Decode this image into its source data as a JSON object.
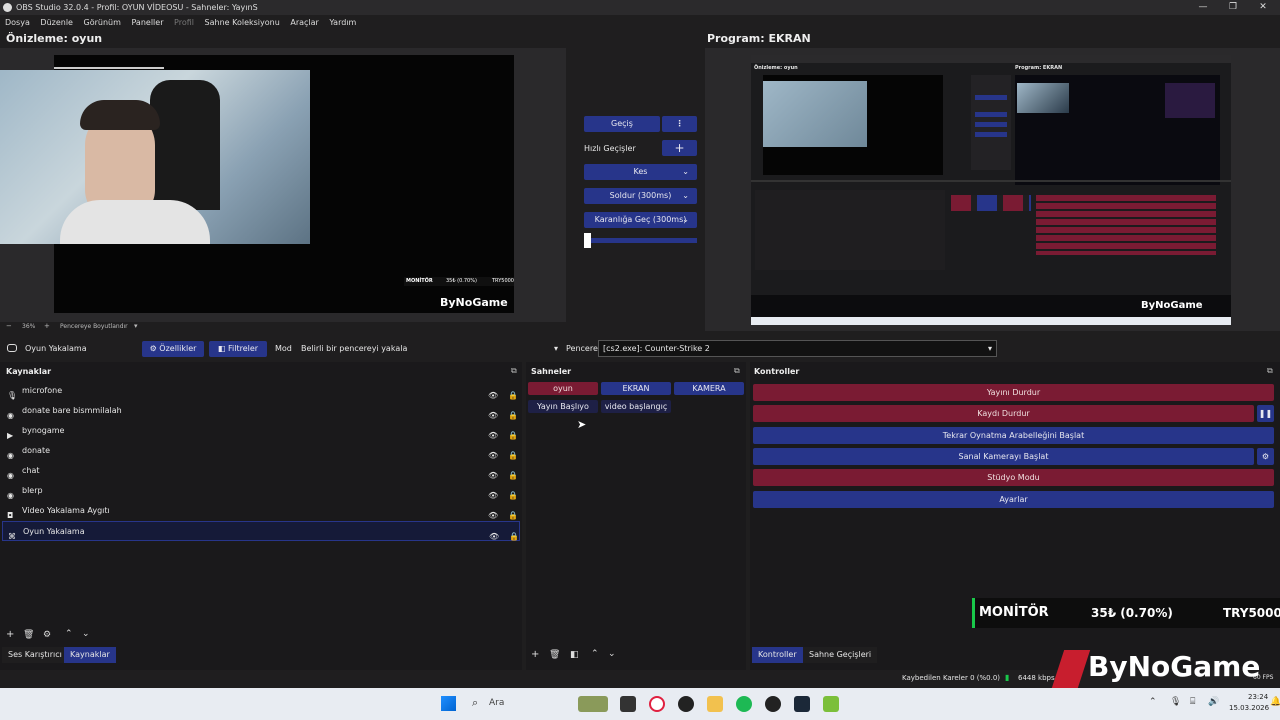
{
  "window": {
    "title": "OBS Studio 32.0.4 - Profil: OYUN VİDEOSU - Sahneler: YayınS",
    "controls": [
      "—",
      "❐",
      "✕"
    ]
  },
  "menu": [
    "Dosya",
    "Düzenle",
    "Görünüm",
    "Paneller",
    "Profil",
    "Sahne Koleksiyonu",
    "Araçlar",
    "Yardım"
  ],
  "preview": {
    "label": "Önizleme: oyun",
    "overlay_monitor": "MONİTÖR",
    "overlay_pct": "35₺ (0.70%)",
    "overlay_try": "TRY5000",
    "brand": "ByNoGame"
  },
  "program": {
    "label": "Program: EKRAN",
    "inner_preview_label": "Önizleme: oyun",
    "inner_program_label": "Program: EKRAN"
  },
  "transitions": {
    "gecis": "Geçiş",
    "hizli": "Hızlı Geçişler",
    "kes": "Kes",
    "soldur": "Soldur (300ms)",
    "karanliga": "Karanlığa Geç (300ms)"
  },
  "zoom": {
    "minus": "−",
    "value": "36%",
    "plus": "+",
    "fit": "Pencereye Boyutlandır"
  },
  "source_bar": {
    "selected": "Oyun Yakalama",
    "properties": "Özellikler",
    "filters": "Filtreler",
    "mode_label": "Mod",
    "mode_value": "Belirli bir pencereyi yakala",
    "window_label": "Pencere",
    "window_value": "[cs2.exe]: Counter-Strike 2"
  },
  "sources": {
    "title": "Kaynaklar",
    "items": [
      {
        "label": "microfone",
        "icon": "microphone-icon"
      },
      {
        "label": "donate bare bismmilalah",
        "icon": "globe-icon"
      },
      {
        "label": "bynogame",
        "icon": "play-icon"
      },
      {
        "label": "donate",
        "icon": "globe-icon"
      },
      {
        "label": "chat",
        "icon": "globe-icon"
      },
      {
        "label": "blerp",
        "icon": "globe-icon"
      },
      {
        "label": "Video Yakalama Aygıtı",
        "icon": "camera-icon"
      },
      {
        "label": "Oyun Yakalama",
        "icon": "gamepad-icon"
      }
    ]
  },
  "scenes": {
    "title": "Sahneler",
    "items": [
      "oyun",
      "EKRAN",
      "KAMERA",
      "Yayın Başlıyo",
      "video başlangıç"
    ]
  },
  "controls": {
    "title": "Kontroller",
    "stop_stream": "Yayını Durdur",
    "stop_record": "Kaydı Durdur",
    "replay": "Tekrar Oynatma Arabelleğini Başlat",
    "virtual_cam": "Sanal Kamerayı Başlat",
    "studio": "Stüdyo Modu",
    "settings": "Ayarlar"
  },
  "bottom_tabs": {
    "mixer": "Ses Karıştırıcı",
    "sources": "Kaynaklar",
    "controls": "Kontroller",
    "transitions": "Sahne Geçişleri"
  },
  "overlay_right": {
    "monitor": "MONİTÖR",
    "pct": "35₺ (0.70%)",
    "try": "TRY5000",
    "brand": "ByNoGame"
  },
  "status": {
    "dropped": "Kaybedilen Kareler 0 (%0.0)",
    "kbps": "6448 kbps",
    "fps": "60 FPS"
  },
  "taskbar": {
    "search": "Ara",
    "time": "23:24",
    "date": "15.03.2026"
  },
  "colors": {
    "blue_button": "#27358a",
    "red_button": "#7a1b33",
    "background": "#1f1e1f"
  }
}
